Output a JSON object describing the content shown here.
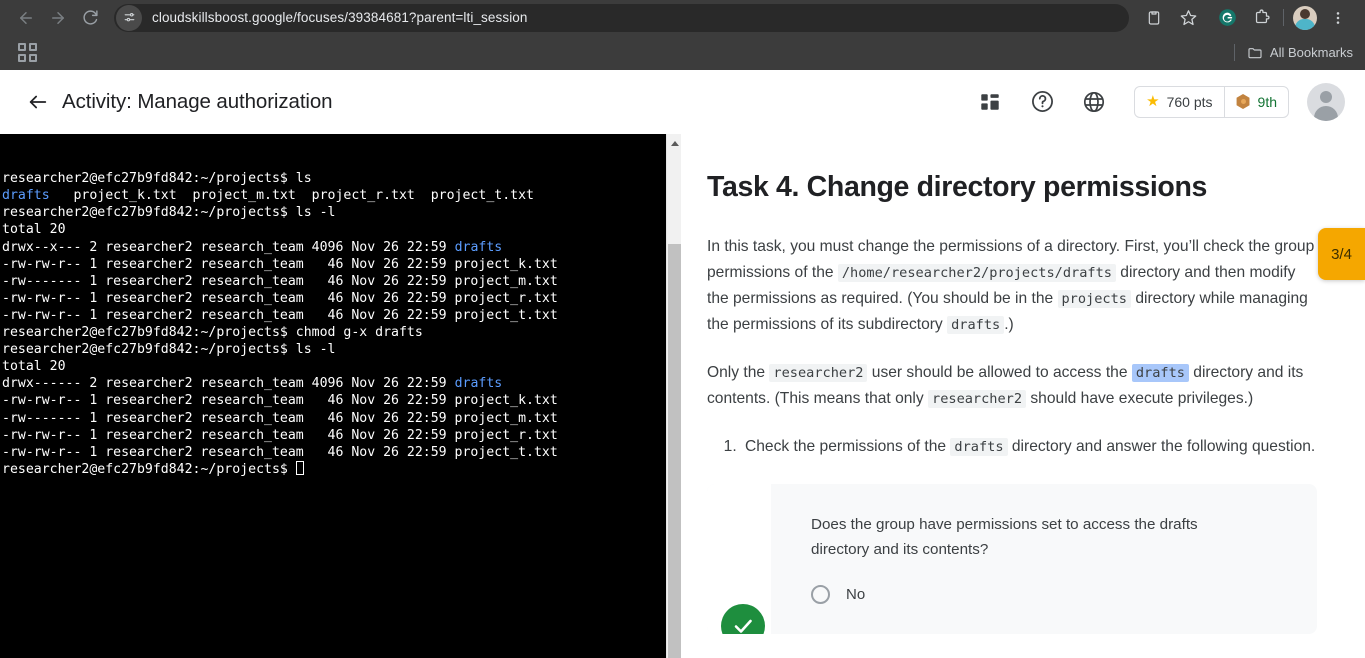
{
  "browser": {
    "url": "cloudskillsboost.google/focuses/39384681?parent=lti_session",
    "back_label": "Back",
    "forward_label": "Forward",
    "reload_label": "Reload",
    "site_settings_label": "View site information",
    "read_list_label": "Reading list",
    "bookmark_label": "Bookmark this tab",
    "grammarly_label": "Grammarly extension",
    "extensions_label": "Extensions",
    "profile_label": "Profile",
    "menu_label": "Customize and control Chrome",
    "apps_label": "Apps",
    "all_bookmarks_label": "All Bookmarks"
  },
  "app_header": {
    "title": "Activity: Manage authorization",
    "back_label": "Back",
    "dashboard_label": "Dashboard",
    "help_label": "Help",
    "language_label": "Language",
    "points": "760 pts",
    "rank": "9th",
    "avatar_label": "Account"
  },
  "terminal": {
    "lines": [
      {
        "prompt": "researcher2@efc27b9fd842:~/projects$ ",
        "text": "ls"
      },
      {
        "dir": "drafts",
        "text": "   project_k.txt  project_m.txt  project_r.txt  project_t.txt"
      },
      {
        "prompt": "researcher2@efc27b9fd842:~/projects$ ",
        "text": "ls -l"
      },
      {
        "text": "total 20"
      },
      {
        "text": "drwx--x--- 2 researcher2 research_team 4096 Nov 26 22:59 ",
        "dir_end": "drafts"
      },
      {
        "text": "-rw-rw-r-- 1 researcher2 research_team   46 Nov 26 22:59 project_k.txt"
      },
      {
        "text": "-rw------- 1 researcher2 research_team   46 Nov 26 22:59 project_m.txt"
      },
      {
        "text": "-rw-rw-r-- 1 researcher2 research_team   46 Nov 26 22:59 project_r.txt"
      },
      {
        "text": "-rw-rw-r-- 1 researcher2 research_team   46 Nov 26 22:59 project_t.txt"
      },
      {
        "prompt": "researcher2@efc27b9fd842:~/projects$ ",
        "text": "chmod g-x drafts"
      },
      {
        "prompt": "researcher2@efc27b9fd842:~/projects$ ",
        "text": "ls -l"
      },
      {
        "text": "total 20"
      },
      {
        "text": "drwx------ 2 researcher2 research_team 4096 Nov 26 22:59 ",
        "dir_end": "drafts"
      },
      {
        "text": "-rw-rw-r-- 1 researcher2 research_team   46 Nov 26 22:59 project_k.txt"
      },
      {
        "text": "-rw------- 1 researcher2 research_team   46 Nov 26 22:59 project_m.txt"
      },
      {
        "text": "-rw-rw-r-- 1 researcher2 research_team   46 Nov 26 22:59 project_r.txt"
      },
      {
        "text": "-rw-rw-r-- 1 researcher2 research_team   46 Nov 26 22:59 project_t.txt"
      },
      {
        "prompt": "researcher2@efc27b9fd842:~/projects$ ",
        "text": "",
        "cursor": true
      }
    ],
    "colors": {
      "background": "#000000",
      "text": "#ffffff",
      "directory": "#5c9dff"
    }
  },
  "content": {
    "title": "Task 4. Change directory permissions",
    "para1": {
      "a": "In this task, you must change the permissions of a directory. First, you’ll check the group permissions of the ",
      "code1": "/home/researcher2/projects/drafts",
      "b": " directory and then modify the permissions as required. (You should be in the ",
      "code2": "projects",
      "c": " directory while managing the permissions of its subdirectory ",
      "code3": "drafts",
      "d": ".)"
    },
    "para2": {
      "a": "Only the ",
      "code1": "researcher2",
      "b": " user should be allowed to access the ",
      "code2": "drafts",
      "c": " directory and its contents. (This means that only ",
      "code3": "researcher2",
      "d": " should have execute privileges.)"
    },
    "step1": {
      "a": "Check the permissions of the ",
      "code1": "drafts",
      "b": " directory and answer the following question."
    },
    "question": "Does the group have permissions set to access the drafts directory and its contents?",
    "options": [
      {
        "label": "No",
        "selected": false
      }
    ],
    "status": "correct",
    "progress_tab": "3/4"
  },
  "colors": {
    "accent_orange": "#f5a700",
    "success_green": "#1e8e3e",
    "selection_blue": "#a8c7fa",
    "terminal_dir_blue": "#5c9dff"
  }
}
